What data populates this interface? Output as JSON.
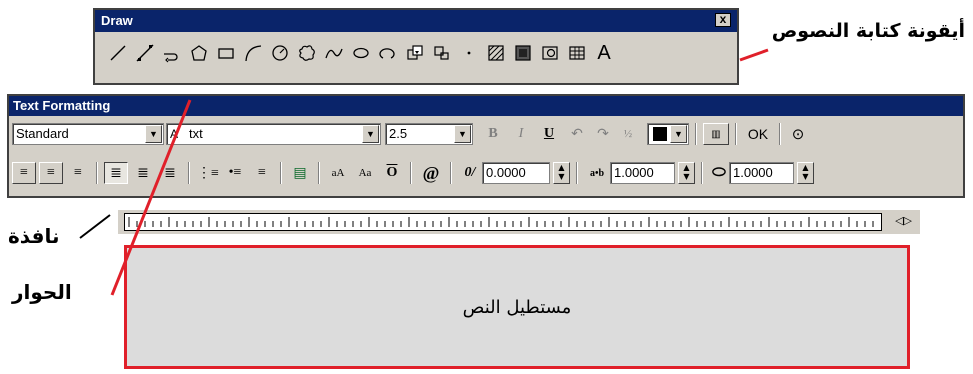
{
  "draw_toolbar": {
    "title": "Draw",
    "close_glyph": "x",
    "icons": [
      "line-icon",
      "construction-line-icon",
      "polyline-icon",
      "polygon-icon",
      "rectangle-icon",
      "arc-icon",
      "circle-icon",
      "revision-cloud-icon",
      "spline-icon",
      "ellipse-icon",
      "ellipse-arc-icon",
      "insert-block-icon",
      "make-block-icon",
      "point-icon",
      "hatch-icon",
      "gradient-icon",
      "region-icon",
      "table-icon",
      "multiline-text-icon"
    ],
    "text_icon_glyph": "A"
  },
  "annotations": {
    "text_icon_label": "أيقونة كتابة النصوص",
    "dialog_label_line1": "نافذة",
    "dialog_label_line2": "الحوار",
    "text_rectangle_label": "مستطيل النص"
  },
  "text_formatting": {
    "title": "Text Formatting",
    "style_value": "Standard",
    "font_icon_glyph": "A",
    "font_value": "txt",
    "height_value": "2.5",
    "bold_glyph": "B",
    "italic_glyph": "I",
    "underline_glyph": "U",
    "color_value": "#000000",
    "ok_label": "OK",
    "oblique_value": "0.0000",
    "tracking_value": "1.0000",
    "width_value": "1.0000",
    "at_glyph": "@",
    "oblique_glyph": "0/",
    "tracking_glyph": "a•b",
    "overline_glyph": "O",
    "uppercase_glyph": "aA",
    "lowercase_glyph": "Aa"
  },
  "colors": {
    "title_bar": "#0a246a",
    "toolbar_bg": "#d4d0c8",
    "highlight_red": "#e0202a",
    "text_area_bg": "#dcdcdc"
  }
}
